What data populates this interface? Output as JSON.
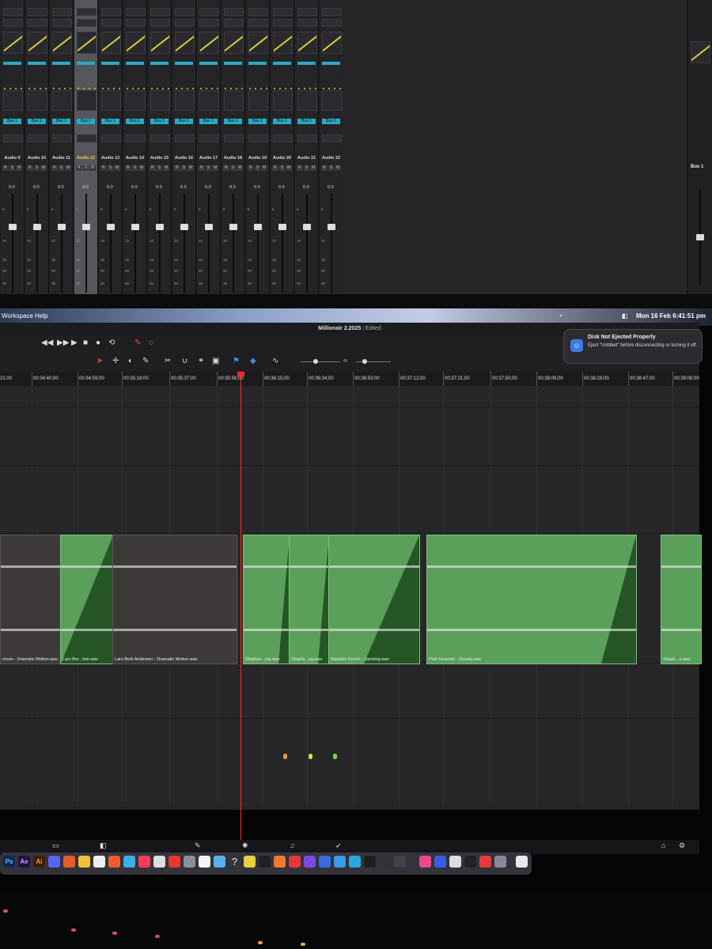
{
  "mixer": {
    "channels": [
      "Audio 9",
      "Audio 10",
      "Audio 11",
      "Audio 12",
      "Audio 13",
      "Audio 14",
      "Audio 15",
      "Audio 16",
      "Audio 17",
      "Audio 18",
      "Audio 19",
      "Audio 20",
      "Audio 21",
      "Audio 22"
    ],
    "selected_channel": "Audio 12",
    "bus_label": "Bus 1",
    "right_bus_label": "Bus 1",
    "rsm": [
      "R",
      "S",
      "M"
    ],
    "gain_value": "0.0",
    "scale": [
      "5",
      "10",
      "15",
      "20",
      "30"
    ]
  },
  "menubar": {
    "items": [
      "Workspace",
      "Help"
    ],
    "clock": "Mon 16 Feb  6:41:51 pm"
  },
  "app": {
    "project_title": "Millionair 2.2025",
    "edited_label": "Edited"
  },
  "timeline": {
    "timecodes": [
      "21:00",
      "00:34:40;00",
      "00:34:59;00",
      "00:35:18;00",
      "00:35:37;00",
      "00:35:56;00",
      "00:36:15;00",
      "00:36:34;00",
      "00:36:53;00",
      "00:37:12;00",
      "00:37:31;00",
      "00:37:50;00",
      "00:38:09;00",
      "00:38:28;00",
      "00:38:47;00",
      "00:39:06;00"
    ],
    "clips": [
      {
        "name": "ersen - Dramatic Motion.wav"
      },
      {
        "name": "Lars Bor...tion.wav"
      },
      {
        "name": "Lars Bork Andersen - Dramatic Motion.wav"
      },
      {
        "name": "Stephen...ing.wav"
      },
      {
        "name": "Stephe...ng.wav"
      },
      {
        "name": "Stephen Keech - Uprising.wav"
      },
      {
        "name": "Piotr Hummel - Gravity.wav"
      },
      {
        "name": "Shado...s.wav"
      }
    ]
  },
  "notification": {
    "title": "Disk Not Ejected Properly",
    "body": "Eject \"Untitled\" before disconnecting or turning it off."
  },
  "dock_apps": [
    "Ps",
    "Ae",
    "Ai",
    "?"
  ]
}
